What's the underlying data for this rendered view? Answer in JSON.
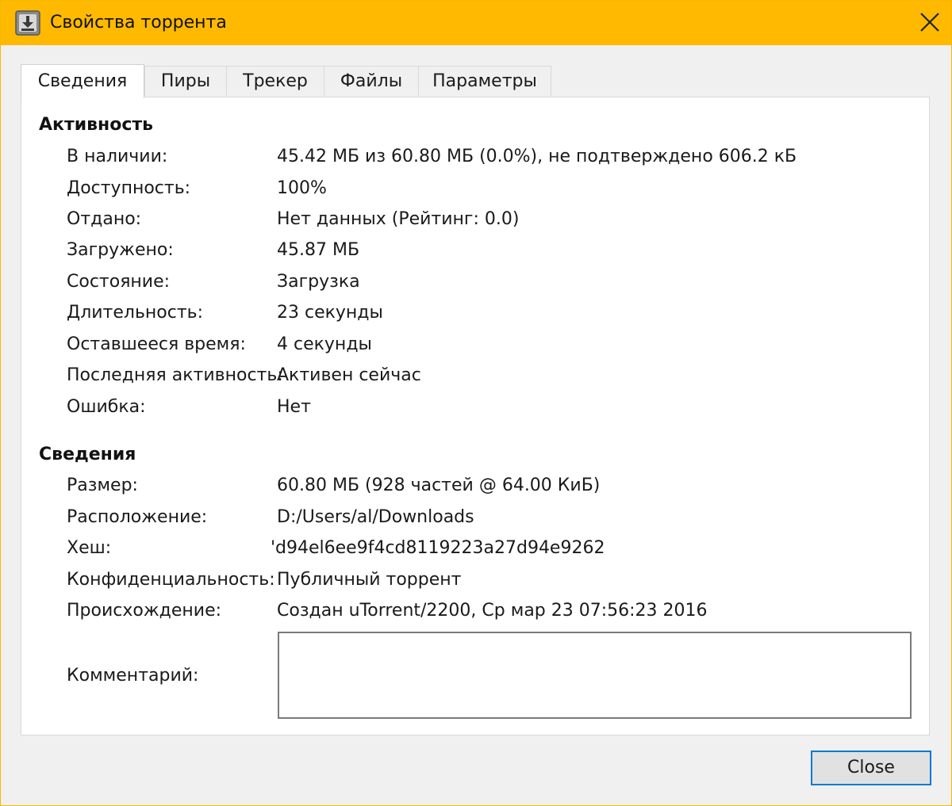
{
  "window": {
    "title": "Свойства торрента",
    "accent_color": "#ffb900",
    "app_icon": "utorrent-download-icon",
    "close_icon": "close-icon"
  },
  "tabs": [
    {
      "label": "Сведения",
      "active": true
    },
    {
      "label": "Пиры",
      "active": false
    },
    {
      "label": "Трекер",
      "active": false
    },
    {
      "label": "Файлы",
      "active": false
    },
    {
      "label": "Параметры",
      "active": false
    }
  ],
  "activity": {
    "title": "Активность",
    "rows": [
      {
        "label": "В наличии:",
        "value": "45.42 МБ из 60.80 МБ (0.0%), не подтверждено 606.2 кБ"
      },
      {
        "label": "Доступность:",
        "value": "100%"
      },
      {
        "label": "Отдано:",
        "value": "Нет данных (Рейтинг: 0.0)"
      },
      {
        "label": "Загружено:",
        "value": "45.87 МБ"
      },
      {
        "label": "Состояние:",
        "value": "Загрузка"
      },
      {
        "label": "Длительность:",
        "value": "23 секунды"
      },
      {
        "label": "Оставшееся время:",
        "value": "4 секунды"
      },
      {
        "label": "Последняя активность:",
        "value": "Активен сейчас"
      },
      {
        "label": "Ошибка:",
        "value": "Нет"
      }
    ]
  },
  "info": {
    "title": "Сведения",
    "rows": [
      {
        "label": "Размер:",
        "value": "60.80 МБ (928 частей @ 64.00 КиБ)"
      },
      {
        "label": "Расположение:",
        "value": "D:/Users/al/Downloads"
      },
      {
        "label": "Хеш:",
        "value": "'d94el6ee9f4cd8119223a27d94e9262"
      },
      {
        "label": "Конфиденциальность:",
        "value": "Публичный торрент"
      },
      {
        "label": "Происхождение:",
        "value": "Создан uTorrent/2200, Ср мар 23 07:56:23 2016"
      }
    ],
    "comment_label": "Комментарий:",
    "comment_value": ""
  },
  "buttons": {
    "close_label": "Close"
  }
}
